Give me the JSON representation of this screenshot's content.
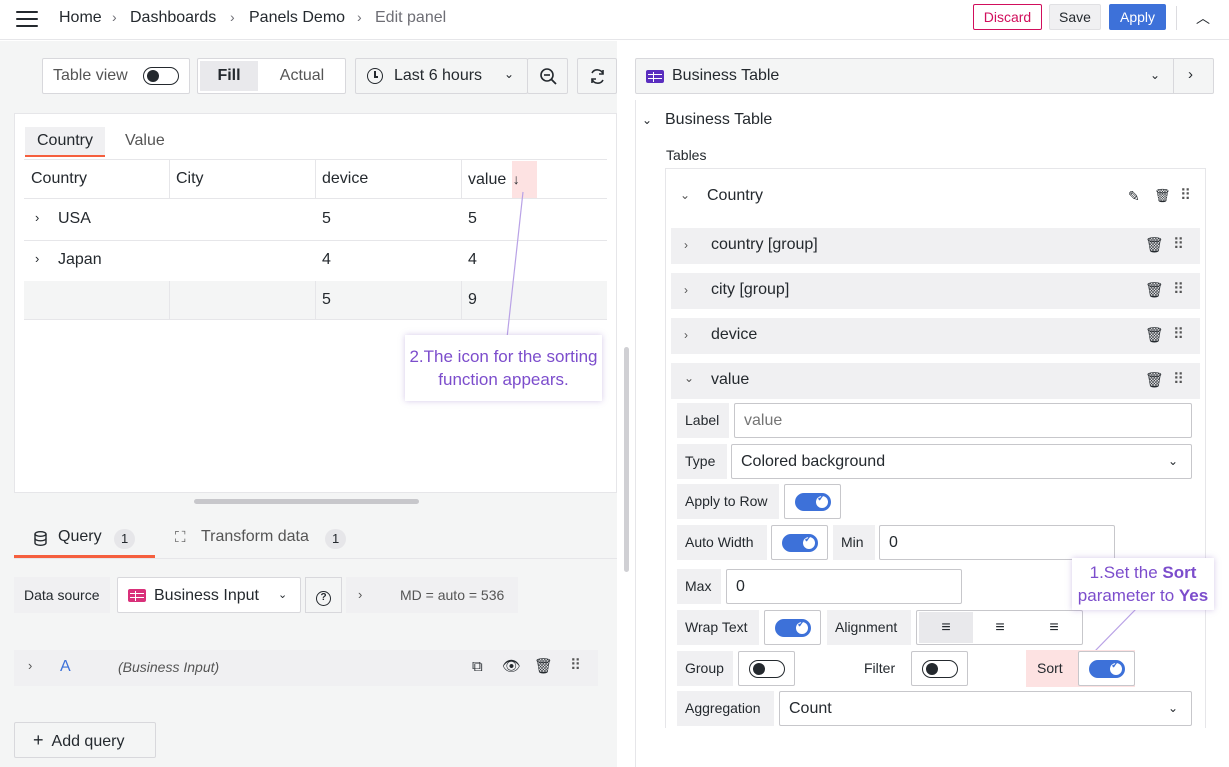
{
  "breadcrumb": [
    "Home",
    "Dashboards",
    "Panels Demo",
    "Edit panel"
  ],
  "toolbar": {
    "discard": "Discard",
    "save": "Save",
    "apply": "Apply"
  },
  "panel_controls": {
    "table_view": "Table view",
    "fill": "Fill",
    "actual": "Actual",
    "time_range": "Last 6 hours"
  },
  "table": {
    "tabs": [
      "Country",
      "Value"
    ],
    "columns": [
      "Country",
      "City",
      "device",
      "value"
    ],
    "sort_icon": "↓",
    "rows": [
      {
        "country": "USA",
        "city": "",
        "device": "5",
        "value": "5"
      },
      {
        "country": "Japan",
        "city": "",
        "device": "4",
        "value": "4"
      }
    ],
    "total": {
      "device": "5",
      "value": "9"
    }
  },
  "annotations": {
    "sort_icon_note": "2.The icon for the sorting function appears.",
    "sort_param_note_prefix": "1.Set the ",
    "sort_param_note_bold1": "Sort",
    "sort_param_note_mid": " parameter to ",
    "sort_param_note_bold2": "Yes"
  },
  "query": {
    "tab_query": "Query",
    "tab_query_count": "1",
    "tab_transform": "Transform data",
    "tab_transform_count": "1",
    "datasource_label": "Data source",
    "datasource_value": "Business Input",
    "md_info": "MD = auto = 536",
    "query_letter": "A",
    "query_source": "(Business Input)",
    "add_query": "Add query"
  },
  "options": {
    "visualization": "Business Table",
    "section_title": "Business Table",
    "tables_label": "Tables",
    "table_name": "Country",
    "groups": [
      "country [group]",
      "city [group]",
      "device",
      "value"
    ],
    "fields": {
      "label_label": "Label",
      "label_placeholder": "value",
      "type_label": "Type",
      "type_value": "Colored background",
      "apply_to_row": "Apply to Row",
      "auto_width": "Auto Width",
      "min_label": "Min",
      "min_value": "0",
      "max_label": "Max",
      "max_value": "0",
      "wrap_text": "Wrap Text",
      "alignment": "Alignment",
      "group": "Group",
      "filter": "Filter",
      "sort": "Sort",
      "aggregation_label": "Aggregation",
      "aggregation_value": "Count"
    }
  },
  "colors": {
    "accent": "#3d71d9",
    "discard": "#d10e5c",
    "annotation": "#7c4dcc",
    "tab_underline": "#f55f3e"
  }
}
